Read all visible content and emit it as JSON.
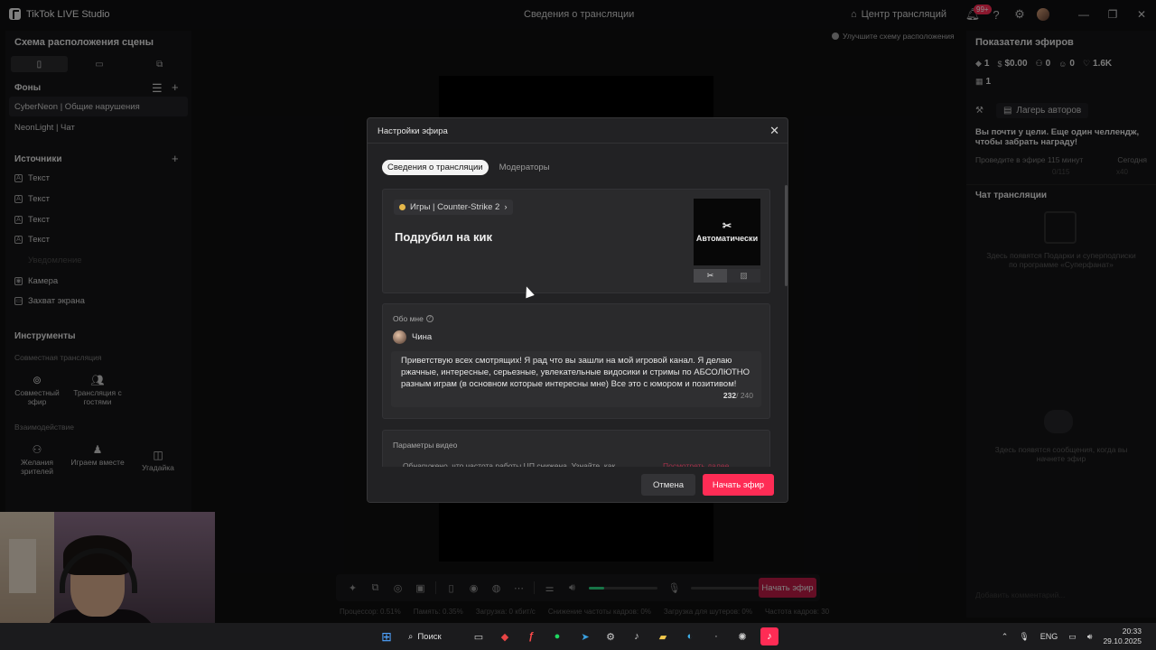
{
  "titlebar": {
    "app_name": "TikTok LIVE Studio",
    "window_title": "Сведения о трансляции",
    "stream_center": "Центр трансляций",
    "notif_badge": "99+"
  },
  "left_panel": {
    "title": "Схема расположения сцены",
    "backgrounds_title": "Фоны",
    "backgrounds": [
      "CyberNeon | Общие нарушения",
      "NeonLight | Чат"
    ],
    "sources_title": "Источники",
    "sources": [
      "Текст",
      "Текст",
      "Текст",
      "Текст"
    ],
    "sources_dim": "Уведомление",
    "sources_extra": [
      "Камера",
      "Захват экрана"
    ],
    "tools_title": "Инструменты",
    "joint_title": "Совместная трансляция",
    "joint_tools": [
      "Совместный эфир",
      "Трансляция с гостями"
    ],
    "interaction_title": "Взаимодействие",
    "interaction_tools": [
      "Желания зрителей",
      "Играем вместе",
      "Угадайка"
    ]
  },
  "center": {
    "hint": "Улучшите схему расположения",
    "start_small": "Начать эфир",
    "volume_fraction": 0.22,
    "stats": [
      "Процессор: 0.51%",
      "Память: 0.35%",
      "Загрузка: 0 кбит/с",
      "Снижение частоты кадров: 0%",
      "Загрузка для шутеров: 0%",
      "Частота кадров: 30"
    ]
  },
  "right_panel": {
    "title": "Показатели эфиров",
    "metrics": [
      {
        "icon": "diamond-icon",
        "value": "1"
      },
      {
        "icon": "dollar-icon",
        "value": "$0.00"
      },
      {
        "icon": "users-icon",
        "value": "0"
      },
      {
        "icon": "person-icon",
        "value": "0"
      },
      {
        "icon": "heart-icon",
        "value": "1.6K"
      }
    ],
    "metric_row2": "1",
    "camp_button": "Лагерь авторов",
    "promo_title": "Вы почти у цели. Еще один челлендж, чтобы забрать награду!",
    "promo_sub": "Проведите в эфире 115 минут",
    "promo_today": "Сегодня",
    "promo_progress": "0/115",
    "promo_multiplier": "x40",
    "chat_title": "Чат трансляции",
    "chat_empty_gifts": "Здесь появятся Подарки и суперподписки по программе «Суперфанат»",
    "chat_empty_messages": "Здесь появятся сообщения, когда вы начнете эфир",
    "chat_input_placeholder": "Добавить комментарий..."
  },
  "modal": {
    "title": "Настройки эфира",
    "tabs": [
      "Сведения о трансляции",
      "Модераторы"
    ],
    "game": "Игры | Counter-Strike 2",
    "stream_name": "Подрубил на кик",
    "cover_label": "Автоматически",
    "about_label": "Обо мне",
    "username": "Чина",
    "bio": "Приветствую всех смотрящих! Я рад что вы зашли на мой игровой канал. Я делаю ржачные, интересные, серьезные, увлекательные видосики и стримы по АБСОЛЮТНО разным играм (в основном которые интересны мне) Все это с юмором и позитивом!",
    "counter_used": "232",
    "counter_max": "/ 240",
    "video_params": "Параметры видео",
    "video_warning": "Обнаружено, что частота работы ЦП снижена. Узнайте, как",
    "video_link": "Посмотреть далее",
    "cancel": "Отмена",
    "start": "Начать эфир"
  },
  "taskbar": {
    "search": "Поиск",
    "lang": "ENG",
    "time": "20:33",
    "date": "29.10.2025"
  },
  "colors": {
    "accent": "#fe2c55",
    "volume": "#2bd482"
  }
}
